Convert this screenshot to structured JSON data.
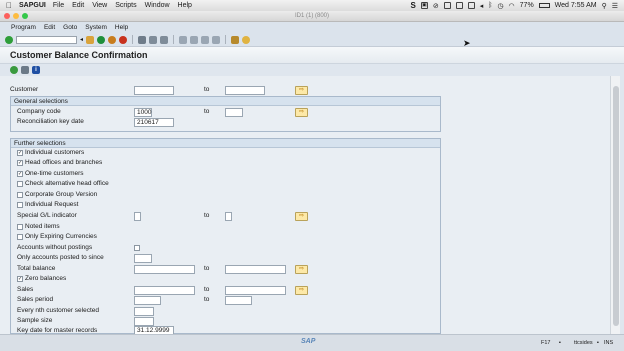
{
  "mac_menu": {
    "app": "SAPGUI",
    "items": [
      "File",
      "Edit",
      "View",
      "Scripts",
      "Window",
      "Help"
    ],
    "battery": "77%",
    "clock": "Wed 7:55 AM"
  },
  "window": {
    "title": "ID1 (1) (800)"
  },
  "sap_menu": {
    "items": [
      "Program",
      "Edit",
      "Goto",
      "System",
      "Help"
    ]
  },
  "page": {
    "title": "Customer Balance Confirmation"
  },
  "customer": {
    "label": "Customer",
    "to": "to"
  },
  "general": {
    "title": "General selections",
    "company_code_label": "Company code",
    "company_code_value": "1000",
    "to": "to",
    "recon_label": "Reconciliation key date",
    "recon_value": "210617"
  },
  "further": {
    "title": "Further selections",
    "checks": [
      {
        "label": "Individual customers",
        "checked": "✓"
      },
      {
        "label": "Head offices and branches",
        "checked": "✓"
      },
      {
        "label": "One-time customers",
        "checked": "✓"
      },
      {
        "label": "Check alternative head office",
        "checked": ""
      },
      {
        "label": "Corporate Group Version",
        "checked": ""
      },
      {
        "label": "Individual Request",
        "checked": ""
      }
    ],
    "special_gl_label": "Special G/L indicator",
    "to": "to",
    "noted_items": "Noted items",
    "only_expiring": "Only Expiring Currencies",
    "accounts_without_postings": "Accounts without postings",
    "only_accounts_posted": "Only accounts posted to since",
    "total_balance": "Total balance",
    "zero_balances": "Zero balances",
    "zero_balances_checked": "✓",
    "sales": "Sales",
    "sales_period": "Sales period",
    "every_nth": "Every nth customer selected",
    "sample_size": "Sample size",
    "key_date_label": "Key date for master records",
    "key_date_value": "31.12.9999"
  },
  "status": {
    "mode": "F17",
    "server": "ttcsides",
    "ins": "INS"
  }
}
